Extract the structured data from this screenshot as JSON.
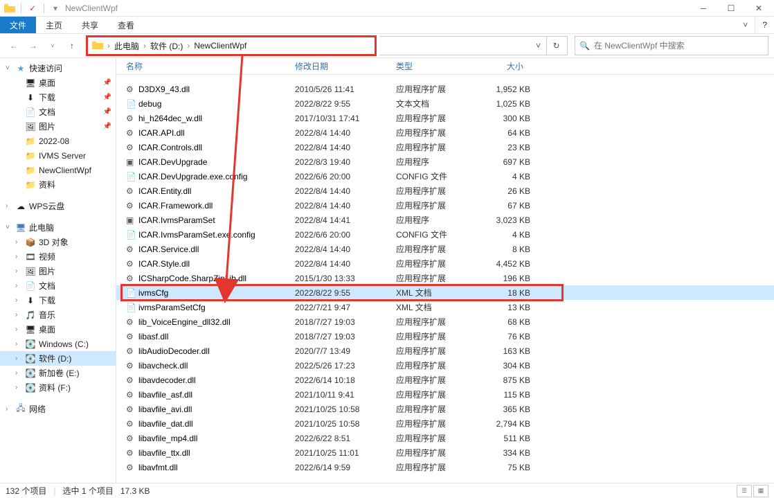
{
  "window": {
    "title": "NewClientWpf"
  },
  "ribbon": {
    "file": "文件",
    "home": "主页",
    "share": "共享",
    "view": "查看"
  },
  "breadcrumb": {
    "a": "此电脑",
    "b": "软件 (D:)",
    "c": "NewClientWpf"
  },
  "search": {
    "placeholder": "在 NewClientWpf 中搜索"
  },
  "columns": {
    "name": "名称",
    "date": "修改日期",
    "type": "类型",
    "size": "大小"
  },
  "sidebar": {
    "quick": "快速访问",
    "items": [
      {
        "label": "桌面",
        "ico": "🖥",
        "pin": true
      },
      {
        "label": "下载",
        "ico": "⬇",
        "pin": true
      },
      {
        "label": "文档",
        "ico": "📄",
        "pin": true
      },
      {
        "label": "图片",
        "ico": "🖼",
        "pin": true
      },
      {
        "label": "2022-08",
        "ico": "📁",
        "pin": false
      },
      {
        "label": "IVMS Server",
        "ico": "📁",
        "pin": false
      },
      {
        "label": "NewClientWpf",
        "ico": "📁",
        "pin": false
      },
      {
        "label": "资料",
        "ico": "📁",
        "pin": false
      }
    ],
    "wps": "WPS云盘",
    "pc": "此电脑",
    "pcitems": [
      {
        "label": "3D 对象",
        "ico": "📦"
      },
      {
        "label": "视频",
        "ico": "🎞"
      },
      {
        "label": "图片",
        "ico": "🖼"
      },
      {
        "label": "文档",
        "ico": "📄"
      },
      {
        "label": "下载",
        "ico": "⬇"
      },
      {
        "label": "音乐",
        "ico": "🎵"
      },
      {
        "label": "桌面",
        "ico": "🖥"
      },
      {
        "label": "Windows (C:)",
        "ico": "💽"
      },
      {
        "label": "软件 (D:)",
        "ico": "💽",
        "selected": true
      },
      {
        "label": "新加卷 (E:)",
        "ico": "💽"
      },
      {
        "label": "资料 (F:)",
        "ico": "💽"
      }
    ],
    "network": "网络"
  },
  "files": [
    {
      "name": "D3DX9_43.dll",
      "date": "2010/5/26 11:41",
      "type": "应用程序扩展",
      "size": "1,952 KB",
      "ico": "⚙"
    },
    {
      "name": "debug",
      "date": "2022/8/22 9:55",
      "type": "文本文档",
      "size": "1,025 KB",
      "ico": "📄"
    },
    {
      "name": "hi_h264dec_w.dll",
      "date": "2017/10/31 17:41",
      "type": "应用程序扩展",
      "size": "300 KB",
      "ico": "⚙"
    },
    {
      "name": "ICAR.API.dll",
      "date": "2022/8/4 14:40",
      "type": "应用程序扩展",
      "size": "64 KB",
      "ico": "⚙"
    },
    {
      "name": "ICAR.Controls.dll",
      "date": "2022/8/4 14:40",
      "type": "应用程序扩展",
      "size": "23 KB",
      "ico": "⚙"
    },
    {
      "name": "ICAR.DevUpgrade",
      "date": "2022/8/3 19:40",
      "type": "应用程序",
      "size": "697 KB",
      "ico": "▣"
    },
    {
      "name": "ICAR.DevUpgrade.exe.config",
      "date": "2022/6/6 20:00",
      "type": "CONFIG 文件",
      "size": "4 KB",
      "ico": "📄"
    },
    {
      "name": "ICAR.Entity.dll",
      "date": "2022/8/4 14:40",
      "type": "应用程序扩展",
      "size": "26 KB",
      "ico": "⚙"
    },
    {
      "name": "ICAR.Framework.dll",
      "date": "2022/8/4 14:40",
      "type": "应用程序扩展",
      "size": "67 KB",
      "ico": "⚙"
    },
    {
      "name": "ICAR.IvmsParamSet",
      "date": "2022/8/4 14:41",
      "type": "应用程序",
      "size": "3,023 KB",
      "ico": "▣"
    },
    {
      "name": "ICAR.IvmsParamSet.exe.config",
      "date": "2022/6/6 20:00",
      "type": "CONFIG 文件",
      "size": "4 KB",
      "ico": "📄"
    },
    {
      "name": "ICAR.Service.dll",
      "date": "2022/8/4 14:40",
      "type": "应用程序扩展",
      "size": "8 KB",
      "ico": "⚙"
    },
    {
      "name": "ICAR.Style.dll",
      "date": "2022/8/4 14:40",
      "type": "应用程序扩展",
      "size": "4,452 KB",
      "ico": "⚙"
    },
    {
      "name": "ICSharpCode.SharpZipLib.dll",
      "date": "2015/1/30 13:33",
      "type": "应用程序扩展",
      "size": "196 KB",
      "ico": "⚙"
    },
    {
      "name": "ivmsCfg",
      "date": "2022/8/22 9:55",
      "type": "XML 文档",
      "size": "18 KB",
      "ico": "📄",
      "selected": true
    },
    {
      "name": "ivmsParamSetCfg",
      "date": "2022/7/21 9:47",
      "type": "XML 文档",
      "size": "13 KB",
      "ico": "📄"
    },
    {
      "name": "lib_VoiceEngine_dll32.dll",
      "date": "2018/7/27 19:03",
      "type": "应用程序扩展",
      "size": "68 KB",
      "ico": "⚙"
    },
    {
      "name": "libasf.dll",
      "date": "2018/7/27 19:03",
      "type": "应用程序扩展",
      "size": "76 KB",
      "ico": "⚙"
    },
    {
      "name": "libAudioDecoder.dll",
      "date": "2020/7/7 13:49",
      "type": "应用程序扩展",
      "size": "163 KB",
      "ico": "⚙"
    },
    {
      "name": "libavcheck.dll",
      "date": "2022/5/26 17:23",
      "type": "应用程序扩展",
      "size": "304 KB",
      "ico": "⚙"
    },
    {
      "name": "libavdecoder.dll",
      "date": "2022/6/14 10:18",
      "type": "应用程序扩展",
      "size": "875 KB",
      "ico": "⚙"
    },
    {
      "name": "libavfile_asf.dll",
      "date": "2021/10/11 9:41",
      "type": "应用程序扩展",
      "size": "115 KB",
      "ico": "⚙"
    },
    {
      "name": "libavfile_avi.dll",
      "date": "2021/10/25 10:58",
      "type": "应用程序扩展",
      "size": "365 KB",
      "ico": "⚙"
    },
    {
      "name": "libavfile_dat.dll",
      "date": "2021/10/25 10:58",
      "type": "应用程序扩展",
      "size": "2,794 KB",
      "ico": "⚙"
    },
    {
      "name": "libavfile_mp4.dll",
      "date": "2022/6/22 8:51",
      "type": "应用程序扩展",
      "size": "511 KB",
      "ico": "⚙"
    },
    {
      "name": "libavfile_ttx.dll",
      "date": "2021/10/25 11:01",
      "type": "应用程序扩展",
      "size": "334 KB",
      "ico": "⚙"
    },
    {
      "name": "libavfmt.dll",
      "date": "2022/6/14 9:59",
      "type": "应用程序扩展",
      "size": "75 KB",
      "ico": "⚙"
    }
  ],
  "status": {
    "count": "132 个项目",
    "sel": "选中 1 个项目",
    "size": "17.3 KB"
  }
}
